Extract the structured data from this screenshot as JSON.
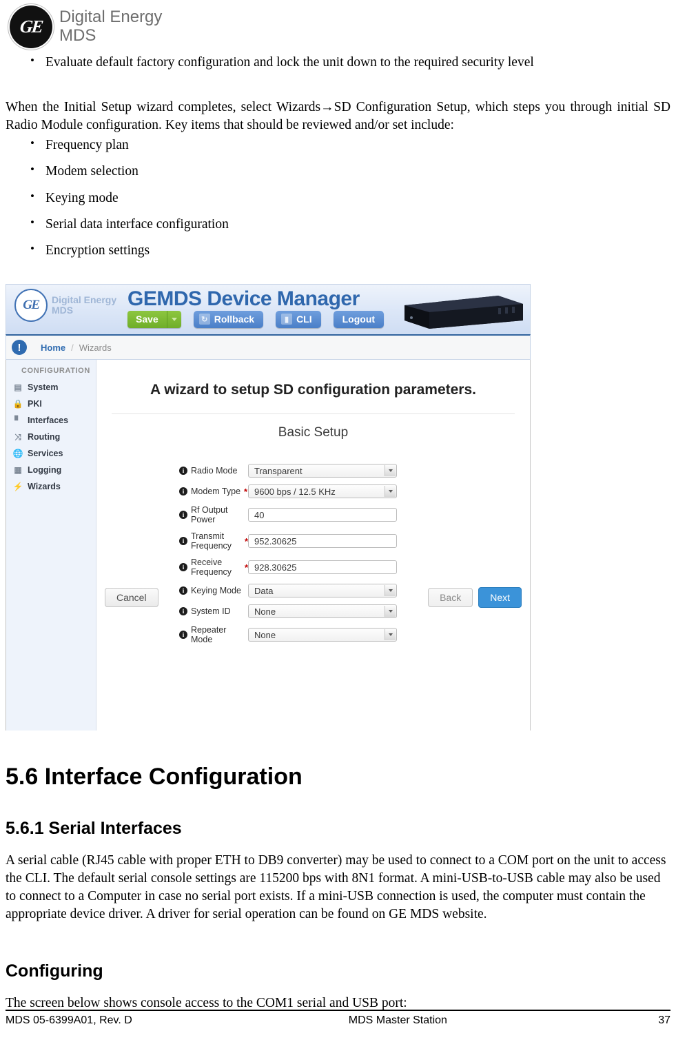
{
  "page_logo": {
    "monogram": "GE",
    "line1": "Digital Energy",
    "line2": "MDS"
  },
  "intro": {
    "bullet_top": "Evaluate default factory configuration and lock the unit down to the required security level",
    "paragraph": "When the Initial Setup wizard completes, select Wizards→SD Configuration Setup, which steps you through initial SD Radio Module configuration. Key items that should be reviewed and/or set include:",
    "items": [
      "Frequency plan",
      "Modem selection",
      "Keying mode",
      "Serial data interface configuration",
      "Encryption settings"
    ]
  },
  "app": {
    "logo": {
      "monogram": "GE",
      "line1": "Digital Energy",
      "line2": "MDS"
    },
    "title": "GEMDS Device Manager",
    "buttons": {
      "save": "Save",
      "rollback": "Rollback",
      "cli": "CLI",
      "logout": "Logout"
    },
    "breadcrumb": {
      "badge": "!",
      "home": "Home",
      "separator": "/",
      "current": "Wizards"
    },
    "sidebar": {
      "heading": "CONFIGURATION",
      "items": [
        {
          "label": "System",
          "icon": "server-icon"
        },
        {
          "label": "PKI",
          "icon": "lock-icon"
        },
        {
          "label": "Interfaces",
          "icon": "bars-icon"
        },
        {
          "label": "Routing",
          "icon": "shuffle-icon"
        },
        {
          "label": "Services",
          "icon": "globe-icon"
        },
        {
          "label": "Logging",
          "icon": "list-icon"
        },
        {
          "label": "Wizards",
          "icon": "wand-icon"
        }
      ]
    },
    "wizard": {
      "title": "A wizard to setup SD configuration parameters.",
      "section": "Basic Setup",
      "fields": [
        {
          "label": "Radio Mode",
          "required": false,
          "type": "select",
          "value": "Transparent"
        },
        {
          "label": "Modem Type",
          "required": true,
          "type": "select",
          "value": "9600 bps / 12.5 KHz"
        },
        {
          "label": "Rf Output Power",
          "required": false,
          "type": "text",
          "value": "40"
        },
        {
          "label": "Transmit Frequency",
          "required": true,
          "type": "text",
          "value": "952.30625"
        },
        {
          "label": "Receive Frequency",
          "required": true,
          "type": "text",
          "value": "928.30625"
        },
        {
          "label": "Keying Mode",
          "required": false,
          "type": "select",
          "value": "Data"
        },
        {
          "label": "System ID",
          "required": false,
          "type": "select",
          "value": "None"
        },
        {
          "label": "Repeater Mode",
          "required": false,
          "type": "select",
          "value": "None"
        }
      ],
      "actions": {
        "cancel": "Cancel",
        "back": "Back",
        "next": "Next"
      }
    },
    "colors": {
      "accent_blue": "#2f67ad",
      "save_green": "#8dc63f",
      "next_blue": "#3b93d9",
      "required_red": "#c00000"
    }
  },
  "sections": {
    "h2_number_title": "5.6 Interface Configuration",
    "h3_number_title": "5.6.1 Serial Interfaces",
    "serial_paragraph": "A serial cable (RJ45 cable with proper ETH to DB9 converter) may be used to connect to a COM port on the unit to access the CLI. The default serial console settings are 115200 bps with 8N1 format. A mini-USB-to-USB cable may also be used to connect to a Computer in case no serial port exists. If a mini-USB connection is used, the computer must contain the appropriate device driver. A driver for serial operation can be found on GE MDS website.",
    "h3_configuring": "Configuring",
    "configuring_paragraph": "The screen below shows console access to the COM1 serial and USB port:"
  },
  "footer": {
    "left": "MDS 05-6399A01, Rev. D",
    "center": "MDS Master Station",
    "right": "37"
  }
}
